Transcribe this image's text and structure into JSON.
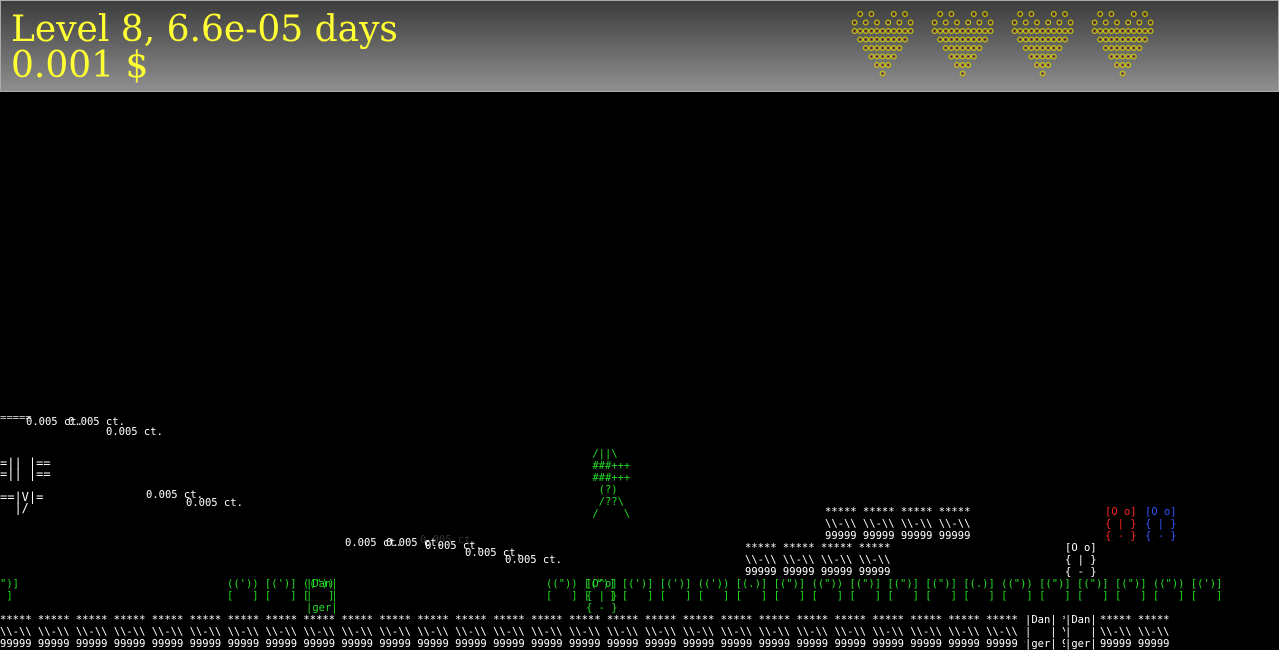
{
  "hud": {
    "level_text": "Level 8, 6.6e-05 days",
    "money_text": "0.001 $",
    "lives": 4,
    "life_icon": "heart-icon",
    "colors": {
      "text": "#ffff33",
      "heart_ring": "#c8c800"
    }
  },
  "field": {
    "coins": [
      {
        "label": "0.005 ct."
      },
      {
        "label": "0.005 ct."
      },
      {
        "label": "0.005 ct."
      },
      {
        "label": "0.005 ct."
      },
      {
        "label": "0.005 ct."
      },
      {
        "label": "0.005 ct."
      },
      {
        "label": "0.005 ct."
      },
      {
        "label": "0.005 ct."
      },
      {
        "label": "0.005 ct."
      },
      {
        "label": "0.005 ct."
      },
      {
        "label": "0.005 ct."
      }
    ],
    "terrain": {
      "ground_top": "***** ***** ***** ***** ***** ***** ***** ***** ***** ***** ***** ***** ***** ***** ***** ***** ***** ***** ***** ***** ***** ***** ***** ***** ***** ***** ***** ***** ***** ***** *****",
      "ground_mid": "\\\\-\\\\ \\\\-\\\\ \\\\-\\\\ \\\\-\\\\ \\\\-\\\\ \\\\-\\\\ \\\\-\\\\ \\\\-\\\\ \\\\-\\\\ \\\\-\\\\ \\\\-\\\\ \\\\-\\\\ \\\\-\\\\ \\\\-\\\\ \\\\-\\\\ \\\\-\\\\ \\\\-\\\\ \\\\-\\\\ \\\\-\\\\ \\\\-\\\\ \\\\-\\\\ \\\\-\\\\ \\\\-\\\\ \\\\-\\\\ \\\\-\\\\ \\\\-\\\\ \\\\-\\\\ \\\\-\\\\ \\\\-\\\\ \\\\-\\\\ \\\\-\\\\",
      "ground_bottom": "99999 99999 99999 99999 99999 99999 99999 99999 99999 99999 99999 99999 99999 99999 99999 99999 99999 99999 99999 99999 99999 99999 99999 99999 99999 99999 99999 99999 99999 99999 99999",
      "platform_a_top": "***** ***** ***** *****",
      "platform_a_mid": "\\\\-\\\\ \\\\-\\\\ \\\\-\\\\ \\\\-\\\\",
      "platform_a_bottom": "99999 99999 99999 99999",
      "platform_b_top": "***** ***** ***** *****",
      "platform_b_mid": "\\\\-\\\\ \\\\-\\\\ \\\\-\\\\ \\\\-\\\\",
      "platform_b_bottom": "99999 99999 99999 99999"
    },
    "bush_row_1": "((')) [(')] ((\"))",
    "bush_row_2": "[   ] [   ] [   ]",
    "bush_row_right_1": "((\")) [(\")] [(')] [(')] ((')) [(.)] [(\")] ((\")) [(\")] [(\")] [(\")] [(.)] ((\")) [(\")] [(\")] [(\")] ((\")) [(')]",
    "bush_row_right_2": "[   ] [   ] [   ] [   ] [   ] [   ] [   ] [   ] [   ] [   ] [   ] [   ] [   ] [   ] [   ] [   ] [   ] [   ]",
    "edge_bush_1": "\")]",
    "edge_bush_2": " ]",
    "danger_signs": [
      {
        "l1": "|Dan|",
        "l2": "|   |",
        "l3": "|ger|"
      },
      {
        "l1": "|Dan|",
        "l2": "|   |",
        "l3": "|ger|"
      },
      {
        "l1": "|Dan|",
        "l2": "|   |",
        "l3": "|ger|"
      }
    ],
    "player": {
      "l1": " /||\\",
      "l2": " ###+++",
      "l3": " ###+++",
      "l4": "  (?)",
      "l5": "  /??\\",
      "l6": " /    \\",
      "color": "#22dd22"
    },
    "enemies": [
      {
        "l1": "[O o]",
        "l2": "{ | }",
        "l3": "{ - }",
        "color": "#ff2222"
      },
      {
        "l1": "[O o]",
        "l2": "{ | }",
        "l3": "{ - }",
        "color": "#3355ff"
      },
      {
        "l1": "[O o]",
        "l2": "{ | }",
        "l3": "{ - }",
        "color": "#ffffff"
      },
      {
        "l1": "[O^o]",
        "l2": "{ | }",
        "l3": "{ - }",
        "color": "#22dd22"
      }
    ],
    "edge_debris": {
      "l1": "=====",
      "l2": "=|| |==",
      "l3": "=|| |==",
      "l4": "==|V|=",
      "l5": "  |/"
    }
  }
}
